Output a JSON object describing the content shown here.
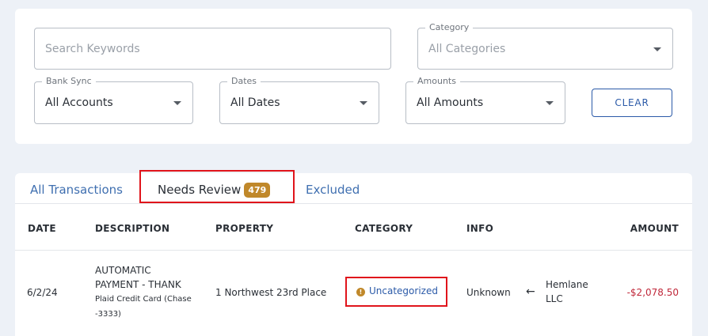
{
  "filters": {
    "search": {
      "placeholder": "Search Keywords"
    },
    "category": {
      "legend": "Category",
      "value": "All Categories"
    },
    "bank_sync": {
      "legend": "Bank Sync",
      "value": "All Accounts"
    },
    "dates": {
      "legend": "Dates",
      "value": "All Dates"
    },
    "amounts": {
      "legend": "Amounts",
      "value": "All Amounts"
    },
    "clear_label": "CLEAR"
  },
  "tabs": [
    {
      "label": "All Transactions",
      "active": false
    },
    {
      "label": "Needs Review",
      "badge": "479",
      "active": true
    },
    {
      "label": "Excluded",
      "active": false
    }
  ],
  "table": {
    "headers": [
      "DATE",
      "DESCRIPTION",
      "PROPERTY",
      "CATEGORY",
      "INFO",
      "AMOUNT"
    ],
    "rows": [
      {
        "date": "6/2/24",
        "description_lines": [
          "AUTOMATIC",
          "PAYMENT - THANK"
        ],
        "account_lines": [
          "Plaid Credit Card (Chase",
          "-3333)"
        ],
        "property": "1 Northwest 23rd Place",
        "category": "Uncategorized",
        "info": "Unknown",
        "payee_lines": [
          "Hemlane",
          "LLC"
        ],
        "amount": "-$2,078.50"
      }
    ]
  },
  "colors": {
    "accent": "#2b5aa8",
    "badge": "#c0882a",
    "negative_amount": "#c0283a",
    "highlight": "#e0141b"
  },
  "icons": {
    "dropdown": "caret-down",
    "category_warning": "info-circle",
    "direction": "arrow-left"
  }
}
